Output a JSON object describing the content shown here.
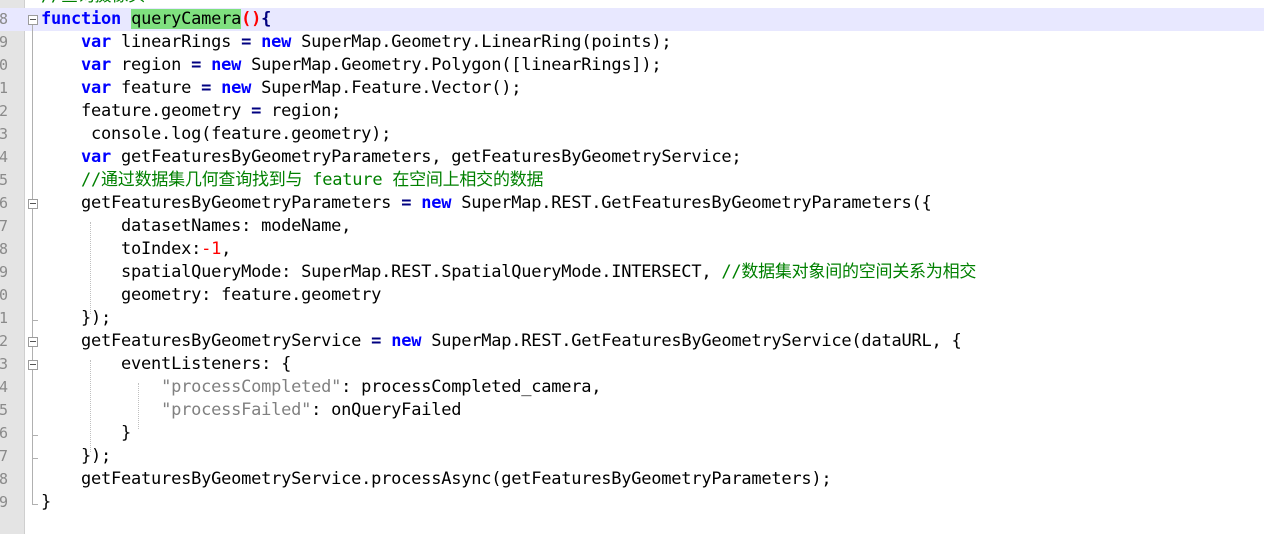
{
  "editor": {
    "top_partial_comment": "//查询摄像头",
    "lines": [
      {
        "num": "8",
        "segs": [
          [
            "function",
            "kw"
          ],
          [
            " ",
            ""
          ],
          [
            "queryCamera",
            "fn"
          ],
          [
            "()",
            "br"
          ],
          [
            "{",
            "op"
          ]
        ]
      },
      {
        "num": "9",
        "segs": [
          [
            "    ",
            ""
          ],
          [
            "var",
            "kw"
          ],
          [
            " linearRings ",
            ""
          ],
          [
            "=",
            "op"
          ],
          [
            " ",
            ""
          ],
          [
            "new",
            "kw"
          ],
          [
            " SuperMap.Geometry.LinearRing(points);",
            ""
          ]
        ]
      },
      {
        "num": "0",
        "segs": [
          [
            "    ",
            ""
          ],
          [
            "var",
            "kw"
          ],
          [
            " region ",
            ""
          ],
          [
            "=",
            "op"
          ],
          [
            " ",
            ""
          ],
          [
            "new",
            "kw"
          ],
          [
            " SuperMap.Geometry.Polygon([linearRings]);",
            ""
          ]
        ]
      },
      {
        "num": "1",
        "segs": [
          [
            "    ",
            ""
          ],
          [
            "var",
            "kw"
          ],
          [
            " feature ",
            ""
          ],
          [
            "=",
            "op"
          ],
          [
            " ",
            ""
          ],
          [
            "new",
            "kw"
          ],
          [
            " SuperMap.Feature.Vector();",
            ""
          ]
        ]
      },
      {
        "num": "2",
        "segs": [
          [
            "    feature.geometry ",
            ""
          ],
          [
            "=",
            "op"
          ],
          [
            " region;",
            ""
          ]
        ]
      },
      {
        "num": "3",
        "segs": [
          [
            "     console.log(feature.geometry);",
            ""
          ]
        ]
      },
      {
        "num": "4",
        "segs": [
          [
            "    ",
            ""
          ],
          [
            "var",
            "kw"
          ],
          [
            " getFeaturesByGeometryParameters, getFeaturesByGeometryService;",
            ""
          ]
        ]
      },
      {
        "num": "5",
        "segs": [
          [
            "    ",
            ""
          ],
          [
            "//通过数据集几何查询找到与 feature 在空间上相交的数据",
            "cm"
          ]
        ]
      },
      {
        "num": "6",
        "segs": [
          [
            "    getFeaturesByGeometryParameters ",
            ""
          ],
          [
            "=",
            "op"
          ],
          [
            " ",
            ""
          ],
          [
            "new",
            "kw"
          ],
          [
            " SuperMap.REST.GetFeaturesByGeometryParameters({",
            ""
          ]
        ]
      },
      {
        "num": "7",
        "segs": [
          [
            "        datasetNames: modeName,",
            ""
          ]
        ]
      },
      {
        "num": "8",
        "segs": [
          [
            "        toIndex:",
            ""
          ],
          [
            "-1",
            "num"
          ],
          [
            ",",
            ""
          ]
        ]
      },
      {
        "num": "9",
        "segs": [
          [
            "        spatialQueryMode: SuperMap.REST.SpatialQueryMode.INTERSECT, ",
            ""
          ],
          [
            "//数据集对象间的空间关系为相交",
            "cm"
          ]
        ]
      },
      {
        "num": "0",
        "segs": [
          [
            "        geometry: feature.geometry",
            ""
          ]
        ]
      },
      {
        "num": "1",
        "segs": [
          [
            "    });",
            ""
          ]
        ]
      },
      {
        "num": "2",
        "segs": [
          [
            "    getFeaturesByGeometryService ",
            ""
          ],
          [
            "=",
            "op"
          ],
          [
            " ",
            ""
          ],
          [
            "new",
            "kw"
          ],
          [
            " SuperMap.REST.GetFeaturesByGeometryService(dataURL, {",
            ""
          ]
        ]
      },
      {
        "num": "3",
        "segs": [
          [
            "        eventListeners: {",
            ""
          ]
        ]
      },
      {
        "num": "4",
        "segs": [
          [
            "            ",
            ""
          ],
          [
            "\"processCompleted\"",
            "st"
          ],
          [
            ": processCompleted_camera,",
            ""
          ]
        ]
      },
      {
        "num": "5",
        "segs": [
          [
            "            ",
            ""
          ],
          [
            "\"processFailed\"",
            "st"
          ],
          [
            ": onQueryFailed",
            ""
          ]
        ]
      },
      {
        "num": "6",
        "segs": [
          [
            "        }",
            ""
          ]
        ]
      },
      {
        "num": "7",
        "segs": [
          [
            "    });",
            ""
          ]
        ]
      },
      {
        "num": "8",
        "segs": [
          [
            "    getFeaturesByGeometryService.processAsync(getFeaturesByGeometryParameters);",
            ""
          ]
        ]
      },
      {
        "num": "9",
        "segs": [
          [
            "}",
            ""
          ]
        ]
      }
    ]
  },
  "colors": {
    "keyword": "#0000ff",
    "comment": "#008000",
    "string": "#808080",
    "number": "#ff0000",
    "highlight": "#7fe07f",
    "current_line": "#e8e8ff"
  }
}
